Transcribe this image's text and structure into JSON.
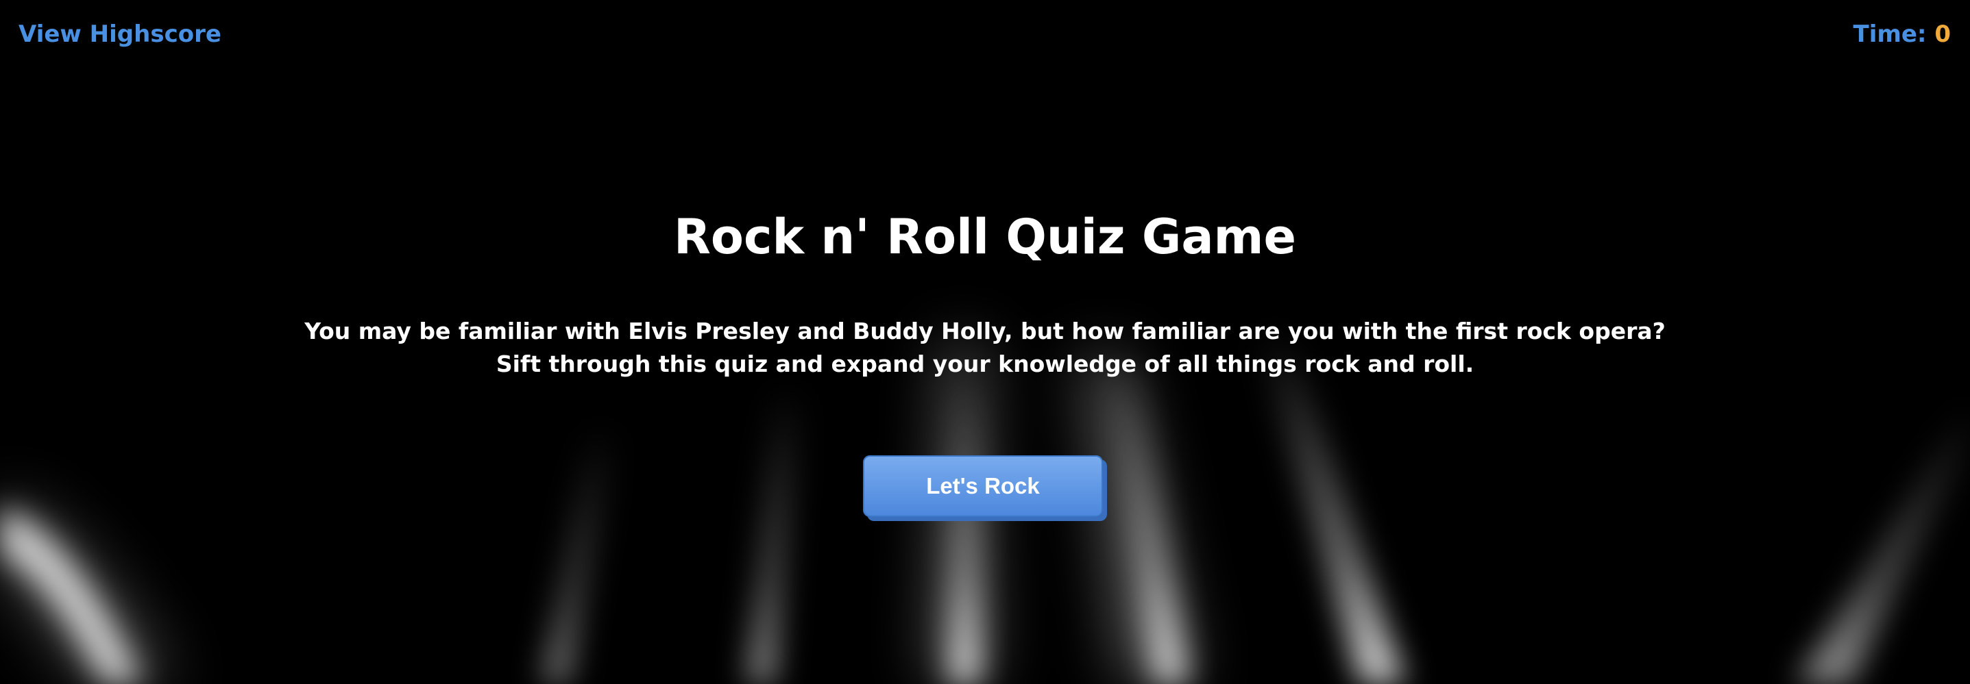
{
  "header": {
    "highscore_link": "View Highscore",
    "timer_label": "Time:",
    "timer_value": "0"
  },
  "intro": {
    "title": "Rock n' Roll Quiz Game",
    "description_line1": "You may be familiar with Elvis Presley and Buddy Holly, but how familiar are you with the first rock opera?",
    "description_line2": "Sift through this quiz and expand your knowledge of all things rock and roll.",
    "start_button": "Let's Rock"
  },
  "colors": {
    "background": "#000000",
    "link_blue": "#4a90e2",
    "timer_orange": "#f0a93b",
    "button_blue": "#5b95e4"
  }
}
